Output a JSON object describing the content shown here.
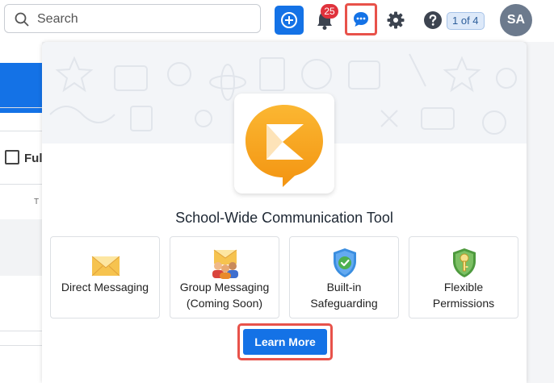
{
  "search": {
    "placeholder": "Search"
  },
  "header": {
    "notification_count": "25",
    "pager": "1 of 4",
    "avatar_initials": "SA"
  },
  "background": {
    "full_label": "Full",
    "column_fragment": "T"
  },
  "popup": {
    "title": "School-Wide Communication Tool",
    "features": [
      {
        "icon": "envelope-icon",
        "label_lines": [
          "Direct Messaging"
        ]
      },
      {
        "icon": "group-envelope-icon",
        "label_lines": [
          "Group Messaging",
          "(Coming Soon)"
        ]
      },
      {
        "icon": "shield-check-icon",
        "label_lines": [
          "Built-in",
          "Safeguarding"
        ]
      },
      {
        "icon": "key-shield-icon",
        "label_lines": [
          "Flexible",
          "Permissions"
        ]
      }
    ],
    "cta": "Learn More"
  },
  "colors": {
    "brand_blue": "#1472e6",
    "highlight_red": "#e8524a",
    "badge_red": "#e0323c",
    "logo_orange": "#f7a21b"
  }
}
